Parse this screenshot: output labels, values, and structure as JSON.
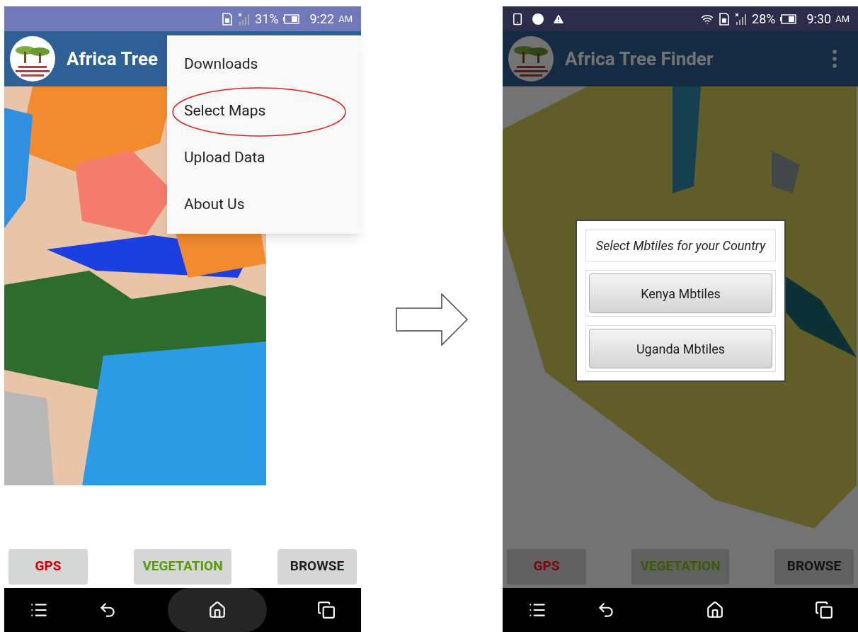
{
  "screens": [
    {
      "status_bar": {
        "notifications": false,
        "wifi": false,
        "battery": "31%",
        "time": "9:22",
        "meridiem": "AM"
      },
      "app_bar": {
        "title": "Africa Tree"
      },
      "dimmed": false,
      "map": {
        "kind": "regions"
      },
      "menu": {
        "items": [
          {
            "label": "Downloads",
            "circled": false
          },
          {
            "label": "Select Maps",
            "circled": true
          },
          {
            "label": "Upload Data",
            "circled": false
          },
          {
            "label": "About Us",
            "circled": false
          }
        ]
      },
      "buttons": [
        {
          "label": "GPS",
          "color": "#cc0000"
        },
        {
          "label": "VEGETATION",
          "color": "#5a9a0a"
        },
        {
          "label": "BROWSE",
          "color": "#222222"
        }
      ],
      "home_pressed": true
    },
    {
      "status_bar": {
        "notifications": true,
        "wifi": true,
        "battery": "28%",
        "time": "9:30",
        "meridiem": "AM"
      },
      "app_bar": {
        "title": "Africa Tree Finder",
        "overflow_menu": true
      },
      "dimmed": true,
      "map": {
        "kind": "vegetation"
      },
      "dialog": {
        "title": "Select Mbtiles for your Country",
        "options": [
          "Kenya Mbtiles",
          "Uganda Mbtiles"
        ]
      },
      "buttons": [
        {
          "label": "GPS",
          "color": "#7a0a0a"
        },
        {
          "label": "VEGETATION",
          "color": "#3a5a0a"
        },
        {
          "label": "BROWSE",
          "color": "#141414"
        }
      ],
      "home_pressed": false
    }
  ]
}
